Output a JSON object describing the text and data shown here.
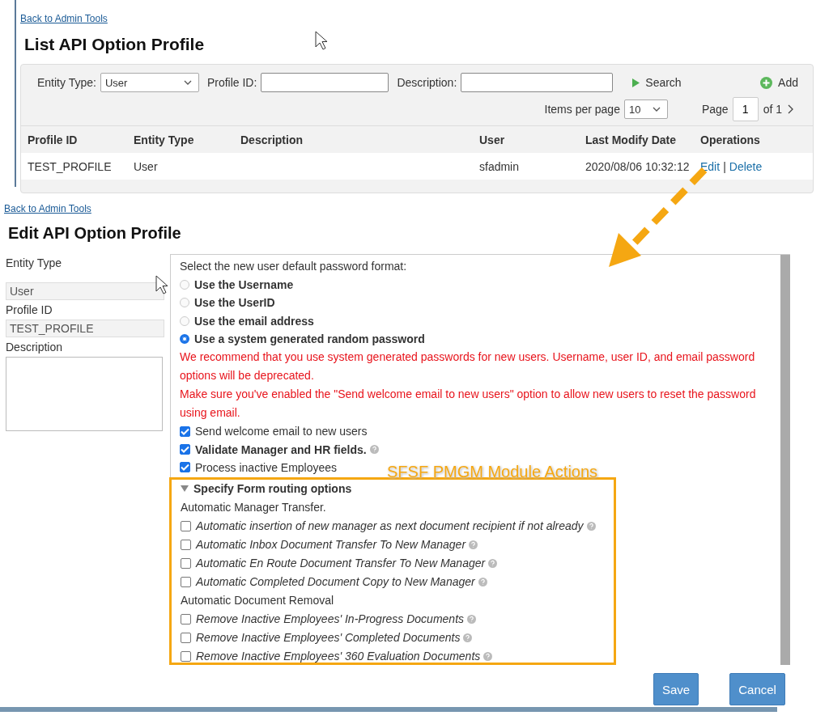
{
  "list_screen": {
    "back_link": "Back to Admin Tools",
    "title": "List API Option Profile",
    "filters": {
      "entity_type_label": "Entity Type:",
      "entity_type_value": "User",
      "profile_id_label": "Profile ID:",
      "description_label": "Description:",
      "search_button": "Search",
      "add_button": "Add"
    },
    "pagination": {
      "items_per_page_label": "Items per page",
      "items_per_page_value": "10",
      "page_label": "Page",
      "page_value": "1",
      "page_of": "of 1"
    },
    "table": {
      "columns": [
        "Profile ID",
        "Entity Type",
        "Description",
        "User",
        "Last Modify Date",
        "Operations"
      ],
      "rows": [
        {
          "cells": [
            "TEST_PROFILE",
            "User",
            "",
            "sfadmin",
            "2020/08/06 10:32:12"
          ],
          "operations": [
            "Edit",
            "Delete"
          ],
          "separator": "|"
        }
      ]
    }
  },
  "edit_screen": {
    "back_link": "Back to Admin Tools",
    "title": "Edit API Option Profile",
    "fields": [
      {
        "label": "Entity Type",
        "value": "User",
        "kind": "input"
      },
      {
        "label": "Profile ID",
        "value": "TEST_PROFILE",
        "kind": "input"
      },
      {
        "label": "Description",
        "kind": "textarea"
      }
    ],
    "password_prompt": "Select the new user default password format:",
    "password_options": [
      {
        "label": "Use the Username",
        "selected": false
      },
      {
        "label": "Use the UserID",
        "selected": false
      },
      {
        "label": "Use the email address",
        "selected": false
      },
      {
        "label": "Use a system generated random password",
        "selected": true
      }
    ],
    "warnings": [
      "We recommend that you use system generated passwords for new users. Username, user ID, and email password options will be deprecated.",
      "Make sure you've enabled the \"Send welcome email to new users\" option to allow new users to reset the password using email."
    ],
    "checks": [
      {
        "label": "Send welcome email to new users",
        "checked": true,
        "bold": false,
        "help": false
      },
      {
        "label": "Validate Manager and HR fields.",
        "checked": true,
        "bold": true,
        "help": true
      },
      {
        "label": "Process inactive Employees",
        "checked": true,
        "bold": false,
        "help": false
      }
    ],
    "routing": {
      "title": "Specify Form routing options",
      "expanded": true,
      "groups": [
        {
          "heading": "Automatic Manager Transfer.",
          "options": [
            {
              "label": "Automatic insertion of new manager as next document recipient if not already",
              "checked": false
            },
            {
              "label": "Automatic Inbox Document Transfer To New Manager",
              "checked": false
            },
            {
              "label": "Automatic En Route Document Transfer To New Manager",
              "checked": false
            },
            {
              "label": "Automatic Completed Document Copy to New Manager",
              "checked": false
            }
          ]
        },
        {
          "heading": "Automatic Document Removal",
          "options": [
            {
              "label": "Remove Inactive Employees' In-Progress Documents",
              "checked": false
            },
            {
              "label": "Remove Inactive Employees' Completed Documents",
              "checked": false
            },
            {
              "label": "Remove Inactive Employees' 360 Evaluation Documents",
              "checked": false
            }
          ]
        }
      ]
    },
    "buttons": [
      "Save",
      "Cancel"
    ]
  },
  "annotation": {
    "callout": "SFSF PMGM Module Actions"
  }
}
